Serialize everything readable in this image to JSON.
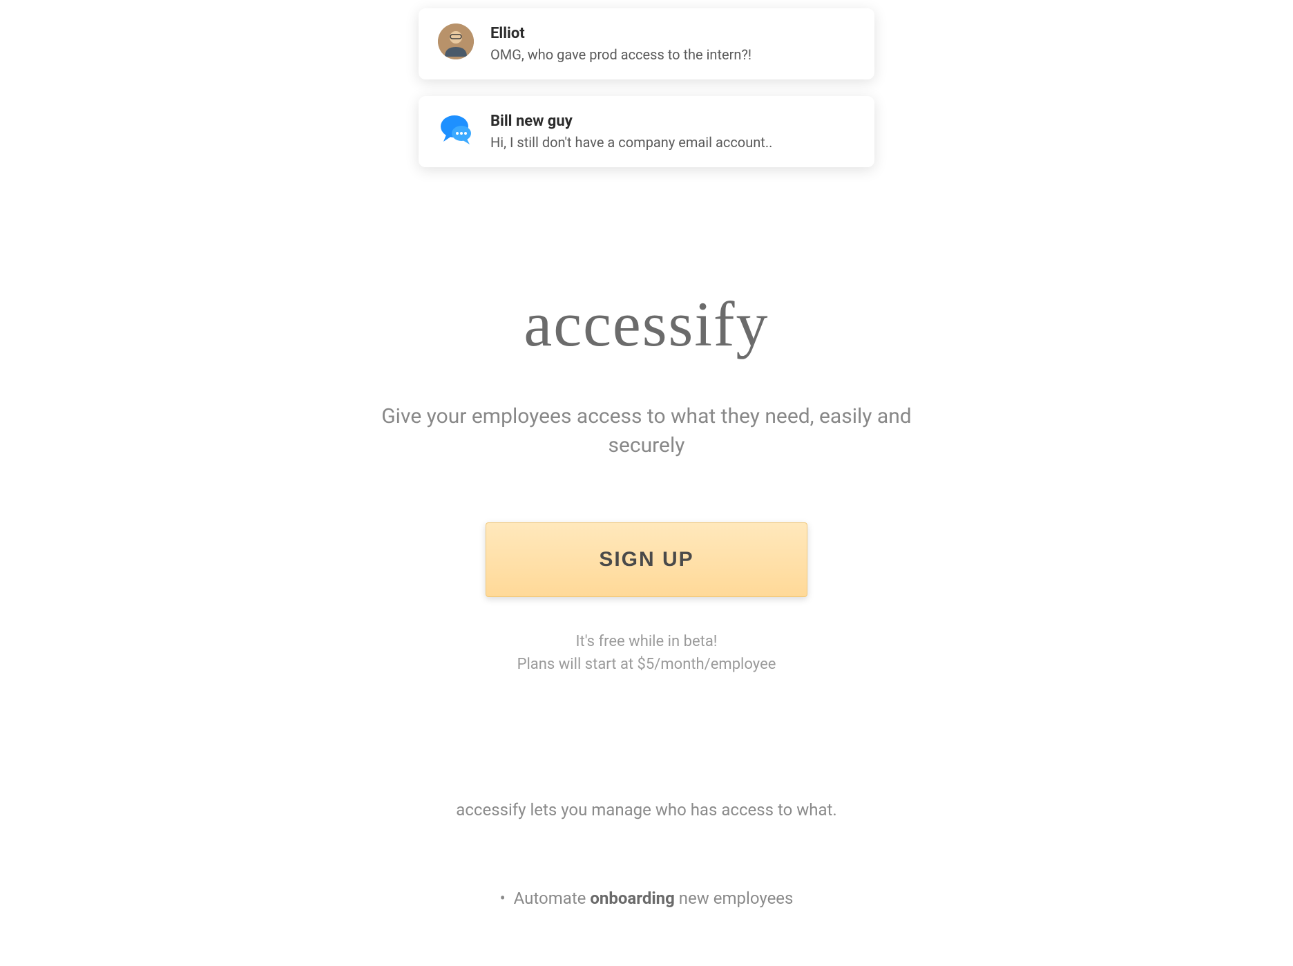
{
  "notifications": [
    {
      "sender": "Elliot",
      "message": "OMG, who gave prod access to the intern?!",
      "icon_type": "avatar"
    },
    {
      "sender": "Bill new guy",
      "message": "Hi, I still don't have a company email account..",
      "icon_type": "chat"
    }
  ],
  "hero": {
    "logo": "accessify",
    "tagline": "Give your employees access to what they need, easily and securely",
    "signup_label": "SIGN UP",
    "pricing_line1": "It's free while in beta!",
    "pricing_line2": "Plans will start at $5/month/employee"
  },
  "description": "accessify lets you manage who has access to what.",
  "features": [
    {
      "prefix": "Automate ",
      "bold": "onboarding",
      "suffix": " new employees"
    }
  ]
}
